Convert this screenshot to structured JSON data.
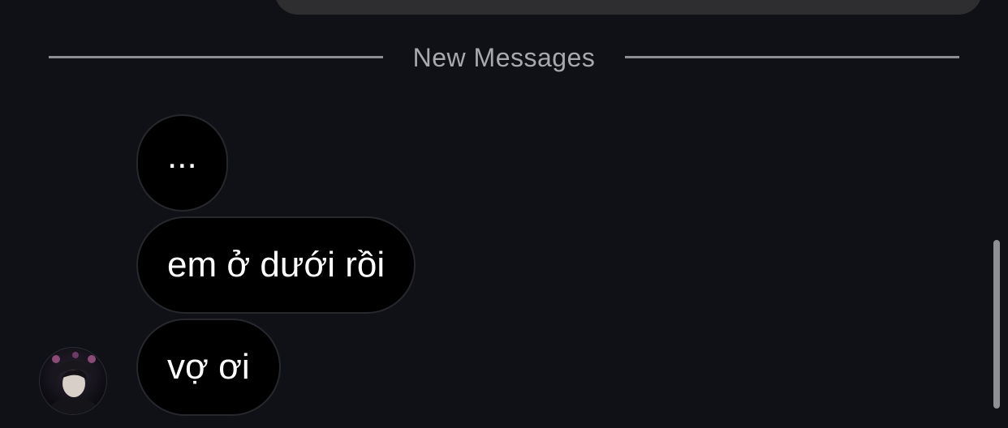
{
  "chat": {
    "divider_label": "New Messages",
    "messages": [
      {
        "text": "..."
      },
      {
        "text": "em ở dưới rồi"
      },
      {
        "text": "vợ ơi"
      }
    ]
  },
  "icons": {
    "avatar": "user-avatar"
  },
  "colors": {
    "background": "#0f1116",
    "bubble": "#000000",
    "bubble_border": "#26282d",
    "divider": "#8c8e94",
    "divider_text": "#a7a9ae",
    "previous_bubble": "#2e2e30",
    "scrollbar": "#8e9096"
  }
}
